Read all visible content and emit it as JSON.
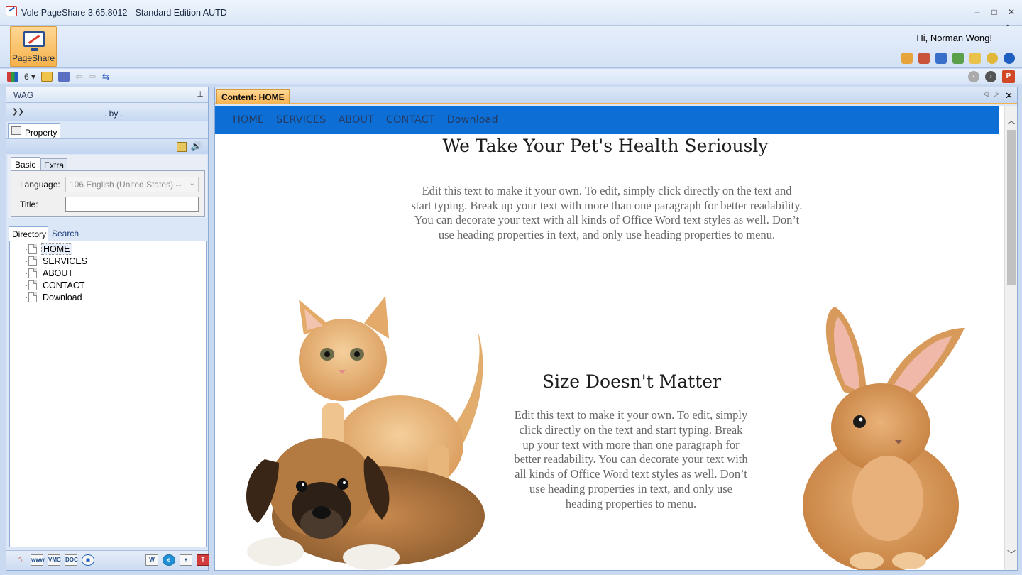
{
  "window": {
    "title": "Vole PageShare  3.65.8012 - Standard Edition AUTD",
    "controls": [
      "–",
      "□",
      "✕"
    ]
  },
  "ribbon": {
    "pageshare_label": "PageShare",
    "greeting": "Hi, Norman Wong!",
    "collapse_glyph": "⌃"
  },
  "toolbar": {
    "count_label": "6 ▾",
    "icons": [
      "stats-icon",
      "save-icon",
      "layers-icon",
      "back-icon",
      "forward-icon",
      "sync-icon"
    ]
  },
  "left_panel": {
    "header": "WAG",
    "pin_glyph": "⌖",
    "byline": ". by .",
    "property_tab": "Property",
    "tabs": {
      "basic": "Basic",
      "extra": "Extra"
    },
    "language_label": "Language:",
    "language_value": "106 English (United States) --",
    "title_label": "Title:",
    "title_value": ".",
    "dir_tabs": {
      "directory": "Directory",
      "search": "Search"
    },
    "tree_items": [
      "HOME",
      "SERVICES",
      "ABOUT",
      "CONTACT",
      "Download"
    ],
    "bottom_icons": [
      "home-icon",
      "web-icon",
      "vmc-icon",
      "doc-icon",
      "view-icon",
      "word-icon",
      "ie-icon",
      "new-doc-icon",
      "t-icon"
    ],
    "bottom_labels": {
      "vmc": "VMC",
      "doc": "DOC",
      "t": "T"
    }
  },
  "content": {
    "tab_label": "Content: HOME",
    "nav": [
      "HOME",
      "SERVICES",
      "ABOUT",
      "CONTACT",
      "Download"
    ],
    "heading1": "We Take Your Pet's Health Seriously",
    "para1": "Edit this text to make it your own. To edit, simply click directly on the text and start typing. Break up your text with more than one paragraph for better readability. You can decorate your text with all kinds of Office Word text styles as well. Don’t use heading properties in text, and only use heading properties to menu.",
    "heading2": "Size Doesn't Matter",
    "para2": "Edit this text to make it your own. To edit, simply click directly on the text and start typing. Break up your text with more than one paragraph for better readability. You can decorate your text with all kinds of Office Word text styles as well. Don’t use heading properties in text, and only use heading properties to menu."
  },
  "colors": {
    "nav_bar": "#0d6fd6",
    "nav_text": "#243b63",
    "active_tab": "#f6b24c",
    "panel_bg": "#dbe6f6"
  }
}
